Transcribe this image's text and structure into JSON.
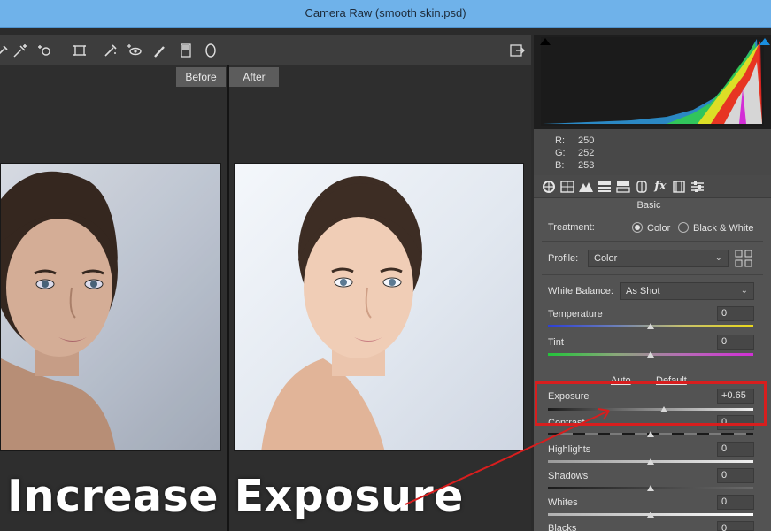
{
  "window": {
    "title": "Camera Raw (smooth skin.psd)"
  },
  "toolbar": {
    "tools": [
      "color-sampler-icon",
      "targeted-adjust-icon",
      "spot-removal-icon",
      "straighten-icon",
      "adjustment-brush-icon",
      "red-eye-icon",
      "brush-icon",
      "graduated-filter-icon",
      "radial-filter-icon"
    ],
    "export_icon": "export-icon"
  },
  "view": {
    "before_label": "Before",
    "after_label": "After"
  },
  "caption": "Increase Exposure",
  "readout": {
    "r_label": "R:",
    "r": "250",
    "g_label": "G:",
    "g": "252",
    "b_label": "B:",
    "b": "253"
  },
  "panel": {
    "title": "Basic",
    "treatment_label": "Treatment:",
    "treatment_color": "Color",
    "treatment_bw": "Black & White",
    "profile_label": "Profile:",
    "profile_value": "Color",
    "wb_label": "White Balance:",
    "wb_value": "As Shot",
    "auto_label": "Auto",
    "default_label": "Default",
    "sliders": [
      {
        "label": "Temperature",
        "value": "0",
        "level": 0.5
      },
      {
        "label": "Tint",
        "value": "0",
        "level": 0.5
      },
      {
        "label": "Exposure",
        "value": "+0.65",
        "level": 0.565
      },
      {
        "label": "Contrast",
        "value": "0",
        "level": 0.5
      },
      {
        "label": "Highlights",
        "value": "0",
        "level": 0.5
      },
      {
        "label": "Shadows",
        "value": "0",
        "level": 0.5
      },
      {
        "label": "Whites",
        "value": "0",
        "level": 0.5
      },
      {
        "label": "Blacks",
        "value": "0",
        "level": 0.5
      }
    ]
  },
  "colors": {
    "accent": "#d81e1e",
    "titlebar": "#6fb2ea",
    "panel": "#535353"
  }
}
